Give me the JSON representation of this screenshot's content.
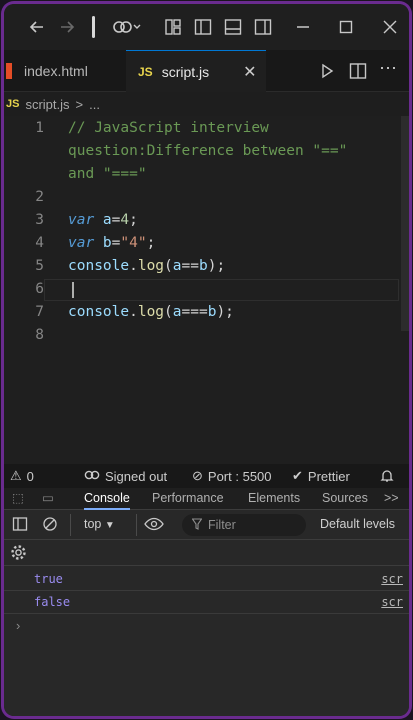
{
  "titlebar": {
    "back_icon": "arrow-left-icon",
    "forward_icon": "arrow-right-icon",
    "copilot_icon": "copilot-icon",
    "layout_icons": [
      "customize-layout-icon",
      "toggle-primary-sidebar-icon",
      "toggle-panel-icon",
      "toggle-secondary-sidebar-icon"
    ],
    "window_controls": [
      "minimize-icon",
      "maximize-icon",
      "close-icon"
    ]
  },
  "tabs": [
    {
      "label": "index.html",
      "type": "html",
      "active": false
    },
    {
      "label": "script.js",
      "type": "js",
      "active": true
    }
  ],
  "tab_badge": "JS",
  "breadcrumb": {
    "file": "script.js",
    "separator": ">",
    "rest": "..."
  },
  "editor": {
    "line_numbers": [
      "1",
      "2",
      "3",
      "4",
      "5",
      "6",
      "7",
      "8"
    ],
    "lines": {
      "l1a": "// JavaScript interview",
      "l1b": "question:Difference between \"==\"",
      "l1c": "and \"===\"",
      "l3_kw": "var",
      "l3_name": " a",
      "l3_op": "=",
      "l3_val": "4",
      "l3_end": ";",
      "l4_kw": "var",
      "l4_name": " b",
      "l4_op": "=",
      "l4_val": "\"4\"",
      "l4_end": ";",
      "l5_obj": "console",
      "l5_dot": ".",
      "l5_fn": "log",
      "l5_open": "(",
      "l5_a": "a",
      "l5_op": "==",
      "l5_b": "b",
      "l5_close": ");",
      "l7_obj": "console",
      "l7_dot": ".",
      "l7_fn": "log",
      "l7_open": "(",
      "l7_a": "a",
      "l7_op": "===",
      "l7_b": "b",
      "l7_close": ");"
    }
  },
  "statusbar": {
    "problems": "0",
    "account": "Signed out",
    "port": "Port : 5500",
    "formatter": "Prettier"
  },
  "devtools": {
    "tabs": [
      "Console",
      "Performance",
      "Elements",
      "Sources"
    ],
    "active_tab": "Console",
    "more": ">>",
    "context": "top",
    "filter_placeholder": "Filter",
    "levels": "Default levels",
    "messages": [
      {
        "value": "true",
        "source": "scr"
      },
      {
        "value": "false",
        "source": "scr"
      }
    ],
    "prompt": "›"
  },
  "colors": {
    "accent": "#0078d4",
    "frame": "#6a2b8f",
    "js_badge": "#e8d44d",
    "console_value": "#9a8cf0"
  }
}
